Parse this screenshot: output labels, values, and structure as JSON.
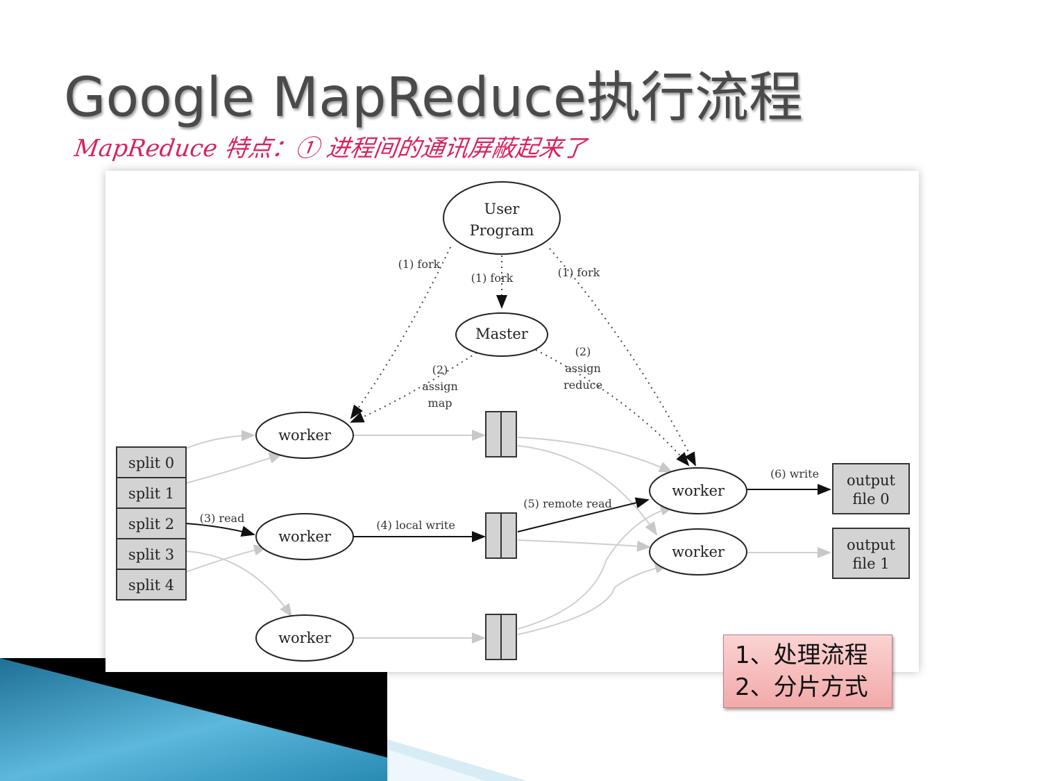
{
  "slide": {
    "title": "Google MapReduce执行流程",
    "handwritten_note": "MapReduce 特点：① 进程间的通讯屏蔽起来了"
  },
  "callout": {
    "lines": [
      "1、处理流程",
      "2、分片方式"
    ]
  },
  "diagram": {
    "user_program": [
      "User",
      "Program"
    ],
    "master": "Master",
    "splits": [
      "split 0",
      "split 1",
      "split 2",
      "split 3",
      "split 4"
    ],
    "worker_label": "worker",
    "outputs": [
      [
        "output",
        "file 0"
      ],
      [
        "output",
        "file 1"
      ]
    ],
    "edge_labels": {
      "fork": "(1) fork",
      "assign_num": "(2)",
      "assign": "assign",
      "map": "map",
      "reduce": "reduce",
      "read": "(3) read",
      "local_write": "(4) local write",
      "remote_read": "(5) remote read",
      "write": "(6) write"
    }
  },
  "colors": {
    "title": "#4a4a4a",
    "annotation": "#d6245f",
    "callout_bg": "#f5b5b5",
    "box_fill": "#d3d3d3",
    "decor_blue": "#2b8fb8"
  }
}
